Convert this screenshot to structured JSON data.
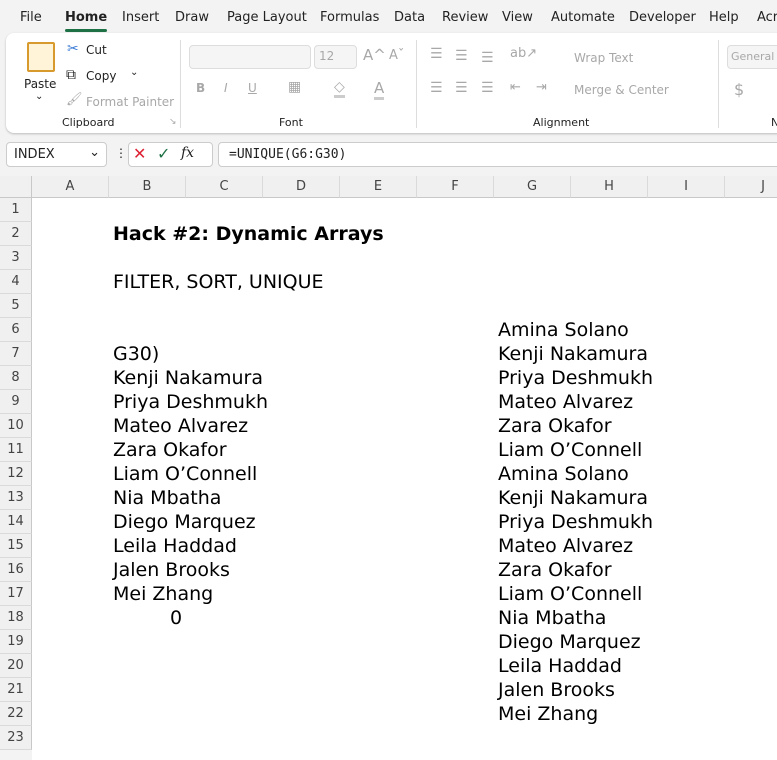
{
  "menu": {
    "tabs": [
      "File",
      "Home",
      "Insert",
      "Draw",
      "Page Layout",
      "Formulas",
      "Data",
      "Review",
      "View",
      "Automate",
      "Developer",
      "Help",
      "Acr"
    ],
    "active": "Home"
  },
  "ribbon": {
    "clipboard": {
      "paste": "Paste",
      "cut": "Cut",
      "copy": "Copy",
      "format_painter": "Format Painter",
      "label": "Clipboard"
    },
    "font": {
      "font_name": "",
      "font_size": "12",
      "bold": "B",
      "italic": "I",
      "underline": "U",
      "font_color": "A",
      "grow": "A^",
      "shrink": "Aˇ",
      "label": "Font"
    },
    "alignment": {
      "wrap_text": "Wrap Text",
      "merge_center": "Merge & Center",
      "label": "Alignment"
    },
    "number": {
      "format": "General",
      "currency": "$",
      "label": "N"
    }
  },
  "formula_bar": {
    "name_box": "INDEX",
    "fx": "fx",
    "formula": "=UNIQUE(G6:G30)"
  },
  "columns": [
    "A",
    "B",
    "C",
    "D",
    "E",
    "F",
    "G",
    "H",
    "I",
    "J"
  ],
  "rows": [
    "1",
    "2",
    "3",
    "4",
    "5",
    "6",
    "7",
    "8",
    "9",
    "10",
    "11",
    "12",
    "13",
    "14",
    "15",
    "16",
    "17",
    "18",
    "19",
    "20",
    "21",
    "22",
    "23"
  ],
  "cells": {
    "B2": "Hack #2: Dynamic Arrays",
    "B4": "FILTER, SORT, UNIQUE",
    "B_list": [
      "G30)",
      "Kenji Nakamura",
      "Priya Deshmukh",
      "Mateo Alvarez",
      "Zara Okafor",
      "Liam O’Connell",
      "Nia Mbatha",
      "Diego Marquez",
      "Leila Haddad",
      "Jalen Brooks",
      "Mei Zhang"
    ],
    "B18": "0",
    "G_list": [
      "Amina Solano",
      "Kenji Nakamura",
      "Priya Deshmukh",
      "Mateo Alvarez",
      "Zara Okafor",
      "Liam O’Connell",
      "Amina Solano",
      "Kenji Nakamura",
      "Priya Deshmukh",
      "Mateo Alvarez",
      "Zara Okafor",
      "Liam O’Connell",
      "Nia Mbatha",
      "Diego Marquez",
      "Leila Haddad",
      "Jalen Brooks",
      "Mei Zhang"
    ]
  }
}
